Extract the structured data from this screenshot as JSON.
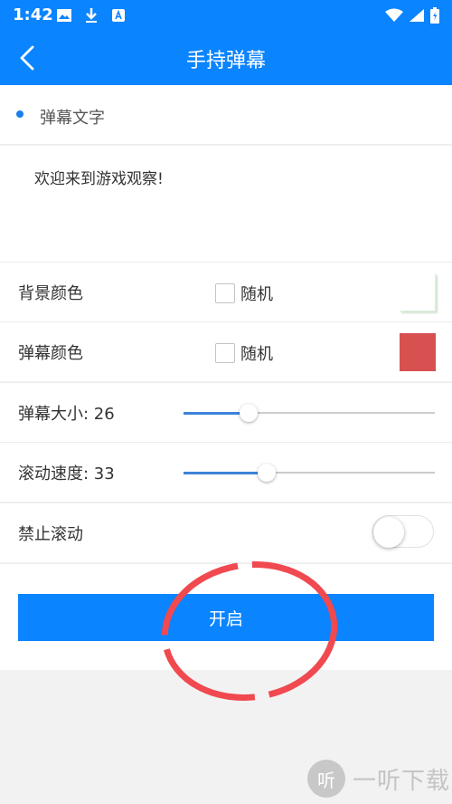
{
  "status_bar": {
    "time": "1:42"
  },
  "app_bar": {
    "title": "手持弹幕"
  },
  "section": {
    "label": "弹幕文字"
  },
  "message": {
    "value": "欢迎来到游戏观察!"
  },
  "settings": {
    "background_color": {
      "label": "背景颜色",
      "random_label": "随机",
      "swatch_color": "#ffffff"
    },
    "danmu_color": {
      "label": "弹幕颜色",
      "random_label": "随机",
      "swatch_color": "#d65150"
    },
    "danmu_size": {
      "label": "弹幕大小: 26",
      "value": 26,
      "fraction": 0.26
    },
    "scroll_speed": {
      "label": "滚动速度: 33",
      "value": 33,
      "fraction": 0.33
    },
    "disable_scroll": {
      "label": "禁止滚动",
      "on": false
    }
  },
  "start_button": {
    "label": "开启"
  },
  "watermark": {
    "logo_char": "听",
    "text": "一听下载"
  },
  "colors": {
    "primary": "#0a84ff",
    "annotation": "#f0494f"
  }
}
